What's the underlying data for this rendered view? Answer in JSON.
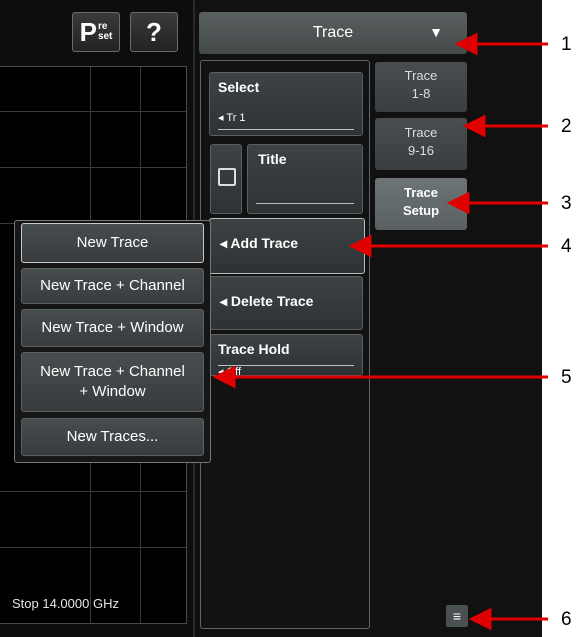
{
  "toolbar": {
    "preset_main": "P",
    "preset_sub_top": "re",
    "preset_sub_bottom": "set",
    "help_label": "?"
  },
  "trace_dropdown": {
    "label": "Trace",
    "arrow": "▼"
  },
  "controls": {
    "select": {
      "title": "Select",
      "value": "Tr 1"
    },
    "title_field": {
      "title": "Title"
    },
    "add_trace": "Add Trace",
    "delete_trace": "Delete Trace",
    "trace_hold": {
      "title": "Trace Hold",
      "value": "Off"
    },
    "arrow_glyph": "◂"
  },
  "side_tabs": [
    {
      "line1": "Trace",
      "line2": "1-8"
    },
    {
      "line1": "Trace",
      "line2": "9-16"
    },
    {
      "line1": "Trace",
      "line2": "Setup"
    }
  ],
  "popup_menu": [
    "New Trace",
    "New Trace + Channel",
    "New Trace + Window",
    "New Trace + Channel",
    "+ Window",
    "New Traces..."
  ],
  "plot": {
    "stop_label": "Stop  14.0000 GHz"
  },
  "callouts": [
    "1",
    "2",
    "3",
    "4",
    "5",
    "6"
  ],
  "colors": {
    "annotation_arrow": "#e00000",
    "panel_bg": "#111111",
    "button": "#3d4244"
  }
}
